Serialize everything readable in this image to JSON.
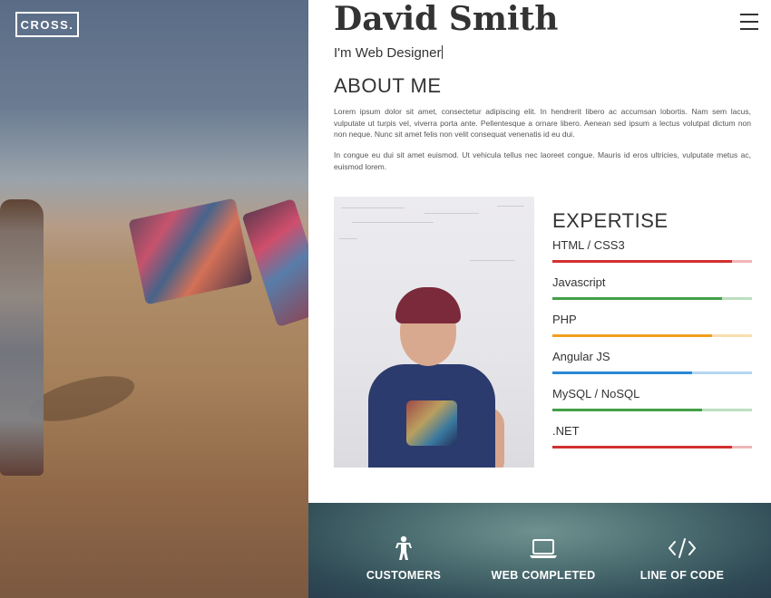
{
  "brand": {
    "logo_text": "CROSS."
  },
  "profile": {
    "name": "David Smith",
    "tagline": "I'm Web Designer"
  },
  "about": {
    "heading": "ABOUT ME",
    "paragraphs": [
      "Lorem ipsum dolor sit amet, consectetur adipiscing elit. In hendrerit libero ac accumsan lobortis. Nam sem lacus, vulputate ut turpis vel, viverra porta ante. Pellentesque a ornare libero. Aenean sed ipsum a lectus volutpat dictum non non neque. Nunc sit amet felis non velit consequat venenatis id eu dui.",
      "In congue eu dui sit amet euismod. Ut vehicula tellus nec laoreet congue. Mauris id eros ultricies, vulputate metus ac, euismod lorem."
    ]
  },
  "expertise": {
    "heading": "EXPERTISE",
    "skills": [
      {
        "label": "HTML / CSS3",
        "level": 0.9,
        "color": "#d32f2f"
      },
      {
        "label": "Javascript",
        "level": 0.85,
        "color": "#43a047"
      },
      {
        "label": "PHP",
        "level": 0.8,
        "color": "#f2a01e"
      },
      {
        "label": "Angular JS",
        "level": 0.7,
        "color": "#2a88d8"
      },
      {
        "label": "MySQL / NoSQL",
        "level": 0.75,
        "color": "#43a047"
      },
      {
        "label": ".NET",
        "level": 0.9,
        "color": "#d32f2f"
      }
    ]
  },
  "stats": [
    {
      "label": "CUSTOMERS",
      "icon": "person-icon"
    },
    {
      "label": "WEB COMPLETED",
      "icon": "laptop-icon"
    },
    {
      "label": "LINE OF CODE",
      "icon": "code-icon"
    }
  ]
}
